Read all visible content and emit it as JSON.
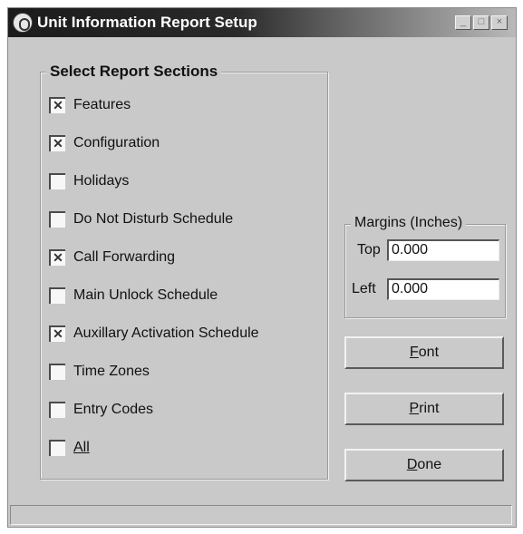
{
  "window": {
    "title": "Unit Information Report Setup",
    "controls": [
      "minimize-icon",
      "maximize-icon",
      "close-icon"
    ]
  },
  "sections": {
    "title": "Select Report Sections",
    "items": [
      {
        "label": "Features",
        "checked": true
      },
      {
        "label": "Configuration",
        "checked": true
      },
      {
        "label": "Holidays",
        "checked": false
      },
      {
        "label": "Do Not Disturb Schedule",
        "checked": false
      },
      {
        "label": "Call Forwarding",
        "checked": true
      },
      {
        "label": "Main Unlock Schedule",
        "checked": false
      },
      {
        "label": "Auxillary Activation Schedule",
        "checked": true
      },
      {
        "label": "Time Zones",
        "checked": false
      },
      {
        "label": "Entry Codes",
        "checked": false
      },
      {
        "label": "All",
        "checked": false
      }
    ]
  },
  "margins": {
    "title": "Margins (Inches)",
    "top_label": "Top",
    "top_value": "0.000",
    "left_label": "Left",
    "left_value": "0.000"
  },
  "buttons": {
    "font": "Font",
    "print": "Print",
    "done": "Done"
  }
}
